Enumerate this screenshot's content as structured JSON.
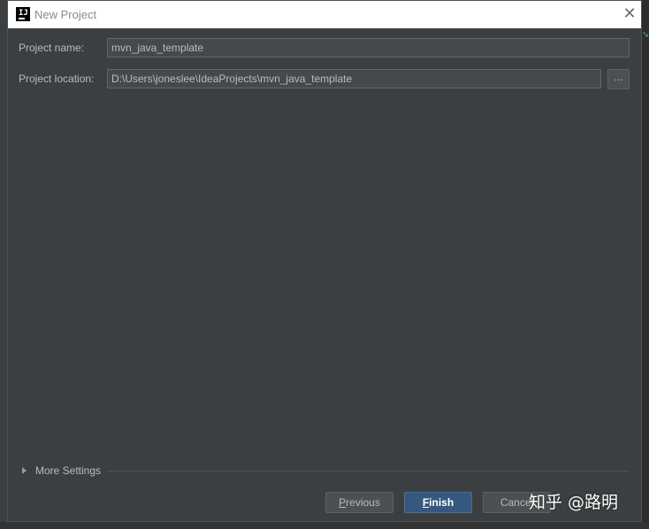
{
  "window": {
    "title": "New Project",
    "app_icon_text": "IJ"
  },
  "form": {
    "project_name_label": "Project name:",
    "project_name_value": "mvn_java_template",
    "project_location_label": "Project location:",
    "project_location_value": "D:\\Users\\joneslee\\IdeaProjects\\mvn_java_template",
    "browse_label": "..."
  },
  "more_settings": {
    "label": "More Settings",
    "expanded": false
  },
  "buttons": {
    "previous_label": "Previous",
    "previous_mnemonic": "P",
    "previous_rest": "revious",
    "finish_label": "Finish",
    "finish_mnemonic": "F",
    "finish_rest": "inish",
    "cancel_label": "Cancel"
  },
  "watermark": {
    "text": "知乎 @路明"
  },
  "colors": {
    "dialog_background": "#3c3f41",
    "input_background": "#45494a",
    "primary_button": "#365880",
    "text": "#bbbbbb"
  }
}
